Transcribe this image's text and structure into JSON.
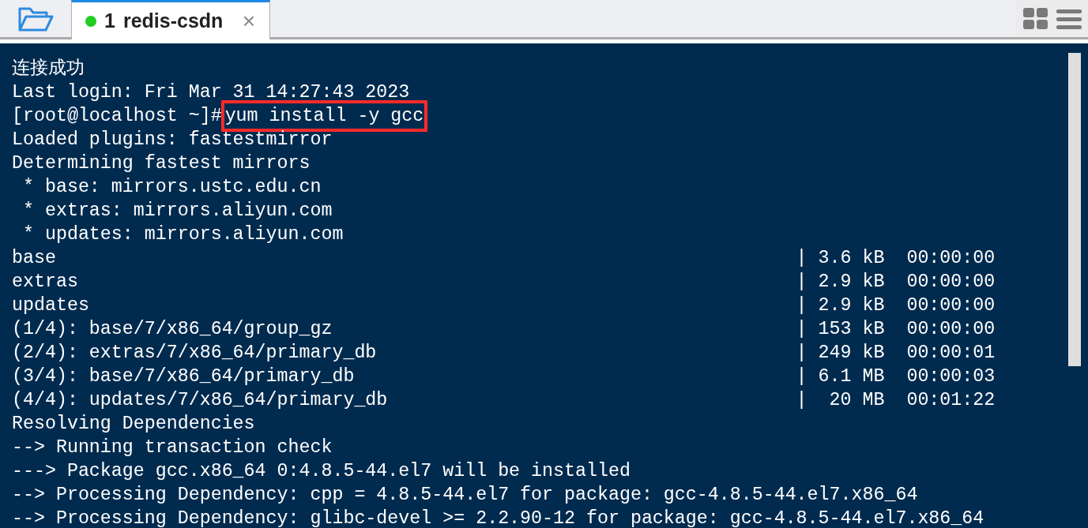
{
  "tabs": [
    {
      "number": "1",
      "label": "redis-csdn",
      "connected": true,
      "selected": true,
      "close": "×"
    }
  ],
  "terminal": {
    "lines": [
      {
        "kind": "text",
        "text": "连接成功"
      },
      {
        "kind": "text",
        "text": "Last login: Fri Mar 31 14:27:43 2023"
      },
      {
        "kind": "command",
        "prompt": "[root@localhost ~]#",
        "command": "yum install -y gcc",
        "highlighted": true
      },
      {
        "kind": "text",
        "text": "Loaded plugins: fastestmirror"
      },
      {
        "kind": "text",
        "text": "Determining fastest mirrors"
      },
      {
        "kind": "text",
        "text": " * base: mirrors.ustc.edu.cn"
      },
      {
        "kind": "text",
        "text": " * extras: mirrors.aliyun.com"
      },
      {
        "kind": "text",
        "text": " * updates: mirrors.aliyun.com"
      },
      {
        "kind": "text",
        "text": "base                                                                   | 3.6 kB  00:00:00"
      },
      {
        "kind": "text",
        "text": "extras                                                                 | 2.9 kB  00:00:00"
      },
      {
        "kind": "text",
        "text": "updates                                                                | 2.9 kB  00:00:00"
      },
      {
        "kind": "text",
        "text": "(1/4): base/7/x86_64/group_gz                                          | 153 kB  00:00:00"
      },
      {
        "kind": "text",
        "text": "(2/4): extras/7/x86_64/primary_db                                      | 249 kB  00:00:01"
      },
      {
        "kind": "text",
        "text": "(3/4): base/7/x86_64/primary_db                                        | 6.1 MB  00:00:03"
      },
      {
        "kind": "text",
        "text": "(4/4): updates/7/x86_64/primary_db                                     |  20 MB  00:01:22"
      },
      {
        "kind": "text",
        "text": "Resolving Dependencies"
      },
      {
        "kind": "text",
        "text": "--> Running transaction check"
      },
      {
        "kind": "text",
        "text": "---> Package gcc.x86_64 0:4.8.5-44.el7 will be installed"
      },
      {
        "kind": "text",
        "text": "--> Processing Dependency: cpp = 4.8.5-44.el7 for package: gcc-4.8.5-44.el7.x86_64"
      },
      {
        "kind": "text",
        "text": "--> Processing Dependency: glibc-devel >= 2.2.90-12 for package: gcc-4.8.5-44.el7.x86_64"
      }
    ]
  }
}
